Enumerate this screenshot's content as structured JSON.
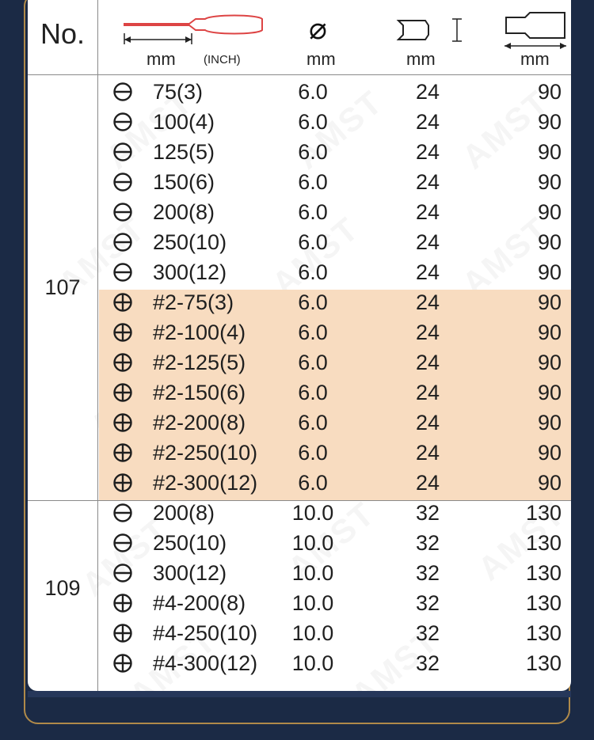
{
  "header": {
    "no_label": "No.",
    "col_size_unit": "mm",
    "col_size_unit2": "(INCH)",
    "col_dia_unit": "mm",
    "col_len_unit": "mm",
    "col_hdl_unit": "mm"
  },
  "watermark": "AMST",
  "groups": [
    {
      "model": "107",
      "rows": [
        {
          "type": "slot",
          "size": "75(3)",
          "dia": "6.0",
          "len": "24",
          "hdl": "90"
        },
        {
          "type": "slot",
          "size": "100(4)",
          "dia": "6.0",
          "len": "24",
          "hdl": "90"
        },
        {
          "type": "slot",
          "size": "125(5)",
          "dia": "6.0",
          "len": "24",
          "hdl": "90"
        },
        {
          "type": "slot",
          "size": "150(6)",
          "dia": "6.0",
          "len": "24",
          "hdl": "90"
        },
        {
          "type": "slot",
          "size": "200(8)",
          "dia": "6.0",
          "len": "24",
          "hdl": "90"
        },
        {
          "type": "slot",
          "size": "250(10)",
          "dia": "6.0",
          "len": "24",
          "hdl": "90"
        },
        {
          "type": "slot",
          "size": "300(12)",
          "dia": "6.0",
          "len": "24",
          "hdl": "90"
        },
        {
          "type": "phillips",
          "size": "#2-75(3)",
          "dia": "6.0",
          "len": "24",
          "hdl": "90"
        },
        {
          "type": "phillips",
          "size": "#2-100(4)",
          "dia": "6.0",
          "len": "24",
          "hdl": "90"
        },
        {
          "type": "phillips",
          "size": "#2-125(5)",
          "dia": "6.0",
          "len": "24",
          "hdl": "90"
        },
        {
          "type": "phillips",
          "size": "#2-150(6)",
          "dia": "6.0",
          "len": "24",
          "hdl": "90"
        },
        {
          "type": "phillips",
          "size": "#2-200(8)",
          "dia": "6.0",
          "len": "24",
          "hdl": "90"
        },
        {
          "type": "phillips",
          "size": "#2-250(10)",
          "dia": "6.0",
          "len": "24",
          "hdl": "90"
        },
        {
          "type": "phillips",
          "size": "#2-300(12)",
          "dia": "6.0",
          "len": "24",
          "hdl": "90"
        }
      ]
    },
    {
      "model": "109",
      "rows": [
        {
          "type": "slot",
          "size": "200(8)",
          "dia": "10.0",
          "len": "32",
          "hdl": "130"
        },
        {
          "type": "slot",
          "size": "250(10)",
          "dia": "10.0",
          "len": "32",
          "hdl": "130"
        },
        {
          "type": "slot",
          "size": "300(12)",
          "dia": "10.0",
          "len": "32",
          "hdl": "130"
        },
        {
          "type": "phillips",
          "size": "#4-200(8)",
          "dia": "10.0",
          "len": "32",
          "hdl": "130"
        },
        {
          "type": "phillips",
          "size": "#4-250(10)",
          "dia": "10.0",
          "len": "32",
          "hdl": "130"
        },
        {
          "type": "phillips",
          "size": "#4-300(12)",
          "dia": "10.0",
          "len": "32",
          "hdl": "130"
        }
      ]
    }
  ],
  "colors": {
    "highlight": "#f8dcc0",
    "background": "#1b2a45",
    "border_gold": "#b08a4a"
  }
}
